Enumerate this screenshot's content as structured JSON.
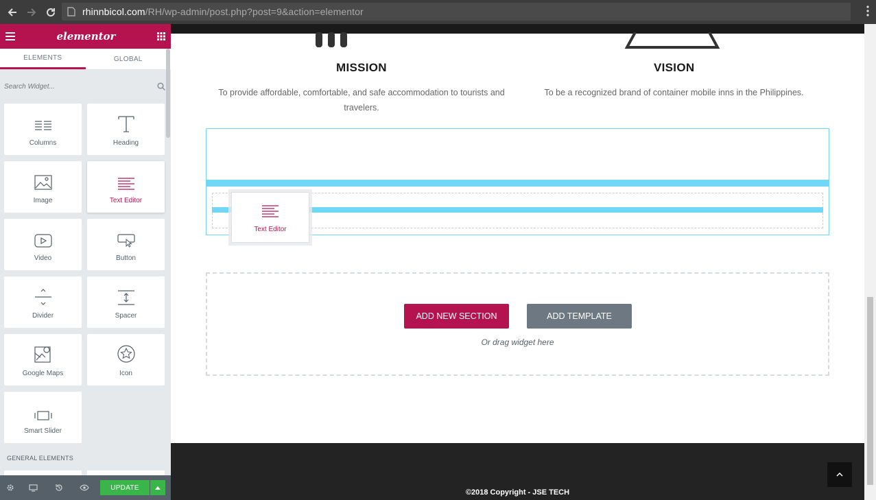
{
  "browser": {
    "url_domain": "rhinnbicol.com",
    "url_path": "/RH/wp-admin/post.php?post=9&action=elementor"
  },
  "sidebar": {
    "logo": "elementor",
    "tabs": [
      "ELEMENTS",
      "GLOBAL"
    ],
    "search_placeholder": "Search Widget...",
    "widgets": [
      {
        "label": "Columns",
        "icon": "columns-icon"
      },
      {
        "label": "Heading",
        "icon": "heading-icon"
      },
      {
        "label": "Image",
        "icon": "image-icon"
      },
      {
        "label": "Text Editor",
        "icon": "text-editor-icon"
      },
      {
        "label": "Video",
        "icon": "video-icon"
      },
      {
        "label": "Button",
        "icon": "button-icon"
      },
      {
        "label": "Divider",
        "icon": "divider-icon"
      },
      {
        "label": "Spacer",
        "icon": "spacer-icon"
      },
      {
        "label": "Google Maps",
        "icon": "google-maps-icon"
      },
      {
        "label": "Icon",
        "icon": "star-icon"
      },
      {
        "label": "Smart Slider",
        "icon": "slider-icon"
      }
    ],
    "section_title": "GENERAL ELEMENTS",
    "update_label": "UPDATE"
  },
  "content": {
    "mission_title": "MISSION",
    "mission_text": "To provide affordable, comfortable, and safe accommodation to tourists and travelers.",
    "vision_title": "VISION",
    "vision_text": "To be a recognized brand of container mobile inns in the Philippines.",
    "drag_widget_label": "Text Editor",
    "add_section_label": "ADD NEW SECTION",
    "add_template_label": "ADD TEMPLATE",
    "drag_hint": "Or drag widget here",
    "copyright": "©2018 Copyright - JSE TECH"
  },
  "colors": {
    "brand": "#b5134f",
    "update_green": "#39b54a",
    "drop_blue": "#71d7f7"
  }
}
